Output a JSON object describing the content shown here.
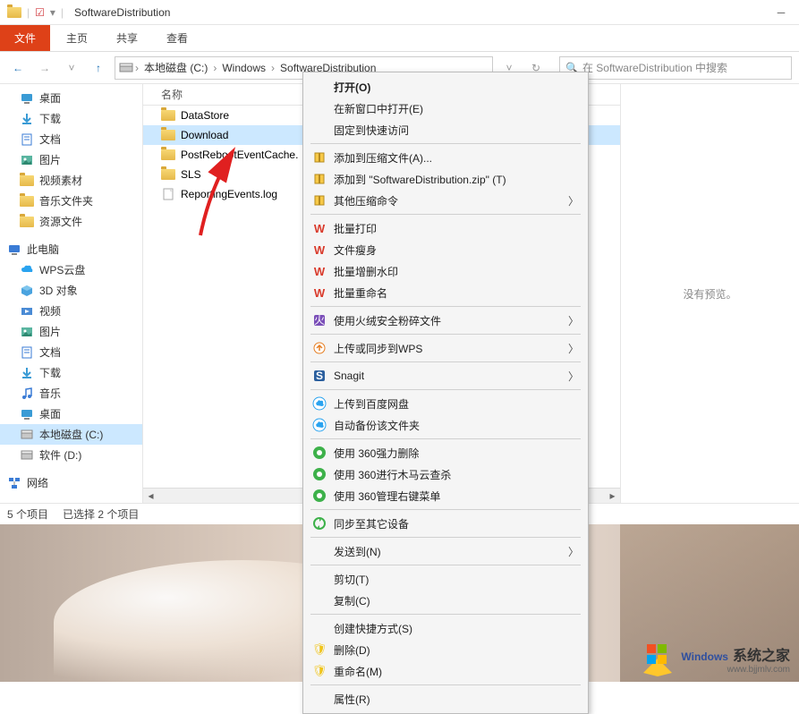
{
  "titlebar": {
    "title": "SoftwareDistribution"
  },
  "ribbon": {
    "file": "文件",
    "home": "主页",
    "share": "共享",
    "view": "查看"
  },
  "breadcrumb": {
    "items": [
      "本地磁盘 (C:)",
      "Windows",
      "SoftwareDistribution"
    ]
  },
  "search": {
    "placeholder": "在 SoftwareDistribution 中搜索"
  },
  "tree": {
    "items": [
      {
        "label": "桌面",
        "icon": "desktop",
        "level": 1
      },
      {
        "label": "下载",
        "icon": "download",
        "level": 1
      },
      {
        "label": "文档",
        "icon": "doc",
        "level": 1
      },
      {
        "label": "图片",
        "icon": "pic",
        "level": 1
      },
      {
        "label": "视频素材",
        "icon": "folder",
        "level": 1
      },
      {
        "label": "音乐文件夹",
        "icon": "folder",
        "level": 1
      },
      {
        "label": "资源文件",
        "icon": "folder",
        "level": 1
      }
    ],
    "pc_label": "此电脑",
    "pc_items": [
      {
        "label": "WPS云盘",
        "icon": "cloud"
      },
      {
        "label": "3D 对象",
        "icon": "3d"
      },
      {
        "label": "视频",
        "icon": "video"
      },
      {
        "label": "图片",
        "icon": "pic"
      },
      {
        "label": "文档",
        "icon": "doc"
      },
      {
        "label": "下载",
        "icon": "download"
      },
      {
        "label": "音乐",
        "icon": "music"
      },
      {
        "label": "桌面",
        "icon": "desktop"
      },
      {
        "label": "本地磁盘 (C:)",
        "icon": "disk",
        "selected": true
      },
      {
        "label": "软件 (D:)",
        "icon": "disk"
      }
    ],
    "network_label": "网络"
  },
  "list": {
    "header_name": "名称",
    "rows": [
      {
        "name": "DataStore",
        "type": "folder",
        "selected": false
      },
      {
        "name": "Download",
        "type": "folder",
        "selected": true
      },
      {
        "name": "PostRebootEventCache.",
        "type": "folder",
        "selected": false
      },
      {
        "name": "SLS",
        "type": "folder",
        "selected": false
      },
      {
        "name": "ReportingEvents.log",
        "type": "file",
        "selected": false
      }
    ]
  },
  "preview": {
    "empty": "没有预览。"
  },
  "status": {
    "count": "5 个项目",
    "selection": "已选择 2 个项目"
  },
  "context_menu": [
    {
      "type": "item",
      "label": "打开(O)",
      "bold": true
    },
    {
      "type": "item",
      "label": "在新窗口中打开(E)"
    },
    {
      "type": "item",
      "label": "固定到快速访问"
    },
    {
      "type": "sep"
    },
    {
      "type": "item",
      "label": "添加到压缩文件(A)...",
      "icon": "archive"
    },
    {
      "type": "item",
      "label": "添加到 \"SoftwareDistribution.zip\" (T)",
      "icon": "archive"
    },
    {
      "type": "item",
      "label": "其他压缩命令",
      "icon": "archive",
      "arrow": true
    },
    {
      "type": "sep"
    },
    {
      "type": "item",
      "label": "批量打印",
      "icon": "wps-w"
    },
    {
      "type": "item",
      "label": "文件瘦身",
      "icon": "wps-w"
    },
    {
      "type": "item",
      "label": "批量增删水印",
      "icon": "wps-w"
    },
    {
      "type": "item",
      "label": "批量重命名",
      "icon": "wps-w"
    },
    {
      "type": "sep"
    },
    {
      "type": "item",
      "label": "使用火绒安全粉碎文件",
      "icon": "huorong",
      "arrow": true
    },
    {
      "type": "sep"
    },
    {
      "type": "item",
      "label": "上传或同步到WPS",
      "icon": "cloud-up",
      "arrow": true
    },
    {
      "type": "sep"
    },
    {
      "type": "item",
      "label": "Snagit",
      "icon": "snagit",
      "arrow": true
    },
    {
      "type": "sep"
    },
    {
      "type": "item",
      "label": "上传到百度网盘",
      "icon": "baidu"
    },
    {
      "type": "item",
      "label": "自动备份该文件夹",
      "icon": "baidu"
    },
    {
      "type": "sep"
    },
    {
      "type": "item",
      "label": "使用 360强力删除",
      "icon": "360"
    },
    {
      "type": "item",
      "label": "使用 360进行木马云查杀",
      "icon": "360"
    },
    {
      "type": "item",
      "label": "使用 360管理右键菜单",
      "icon": "360"
    },
    {
      "type": "sep"
    },
    {
      "type": "item",
      "label": "同步至其它设备",
      "icon": "sync"
    },
    {
      "type": "sep"
    },
    {
      "type": "item",
      "label": "发送到(N)",
      "arrow": true
    },
    {
      "type": "sep"
    },
    {
      "type": "item",
      "label": "剪切(T)"
    },
    {
      "type": "item",
      "label": "复制(C)"
    },
    {
      "type": "sep"
    },
    {
      "type": "item",
      "label": "创建快捷方式(S)"
    },
    {
      "type": "item",
      "label": "删除(D)",
      "shield": true
    },
    {
      "type": "item",
      "label": "重命名(M)",
      "shield": true
    },
    {
      "type": "sep"
    },
    {
      "type": "item",
      "label": "属性(R)"
    }
  ],
  "watermark": {
    "primary": "Windows",
    "suffix": "系统之家",
    "url": "www.bjjmlv.com"
  }
}
